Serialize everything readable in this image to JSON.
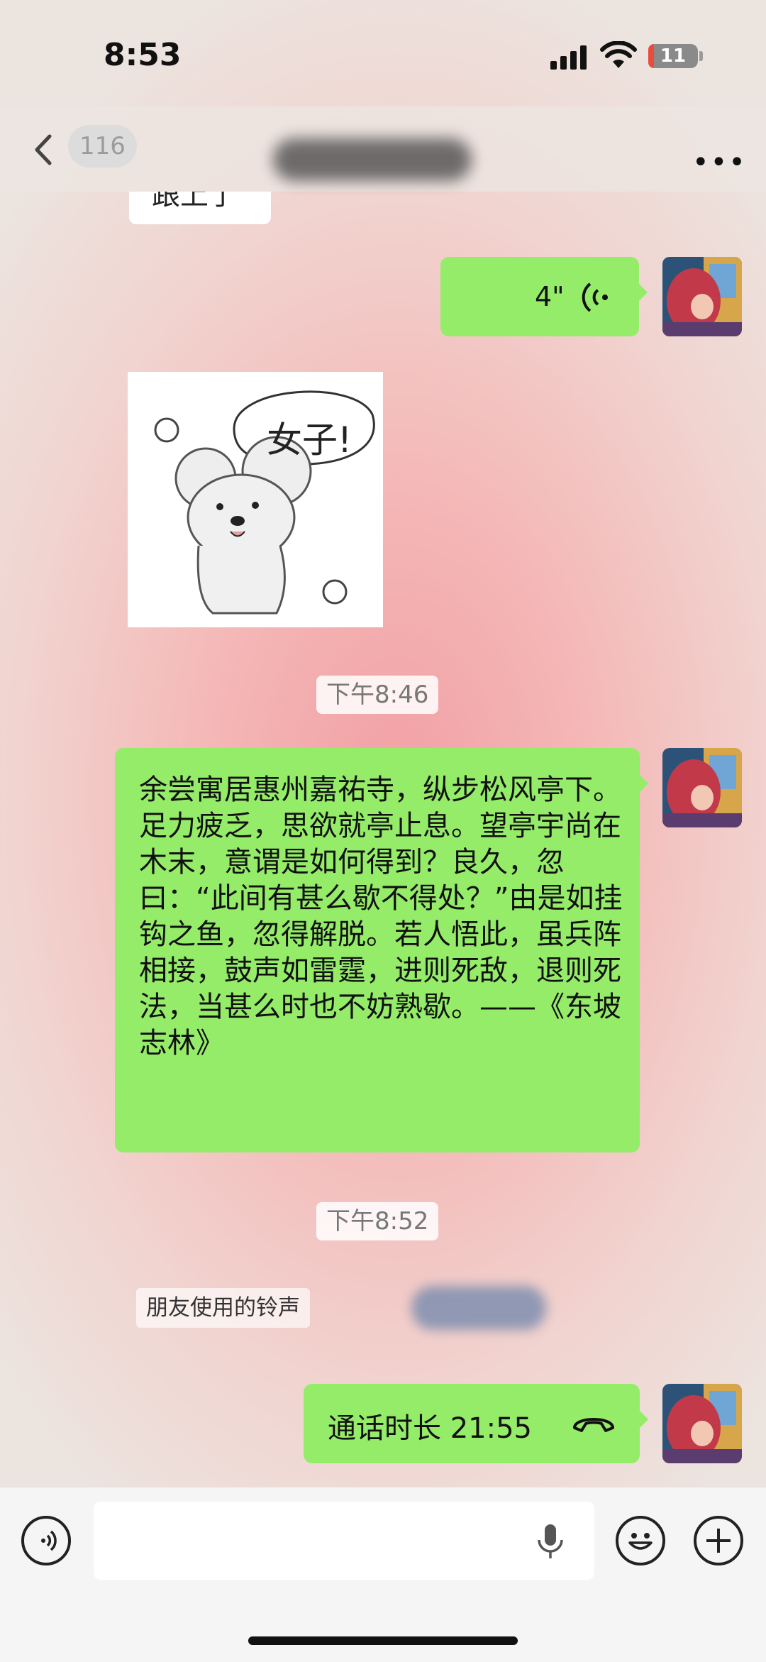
{
  "status_bar": {
    "time": "8:53",
    "battery": "11"
  },
  "nav": {
    "unread_count": "116"
  },
  "top_partial_text": "跟上了",
  "voice_message": {
    "duration": "4\""
  },
  "sticker": {
    "caption": "女子!"
  },
  "timestamps": [
    "下午8:46",
    "下午8:52"
  ],
  "text_message": "余尝寓居惠州嘉祐寺，纵步松风亭下。足力疲乏，思欲就亭止息。望亭宇尚在木末，意谓是如何得到？良久，忽曰：“此间有甚么歇不得处？”由是如挂钩之鱼，忽得解脱。若人悟此，虽兵阵相接，鼓声如雷霆，进则死敌，退则死法，当甚么时也不妨熟歇。——《东坡志林》",
  "system_note": "朋友使用的铃声",
  "call_message": {
    "label": "通话时长 21:55"
  },
  "colors": {
    "bubble_green": "#95ec69"
  }
}
